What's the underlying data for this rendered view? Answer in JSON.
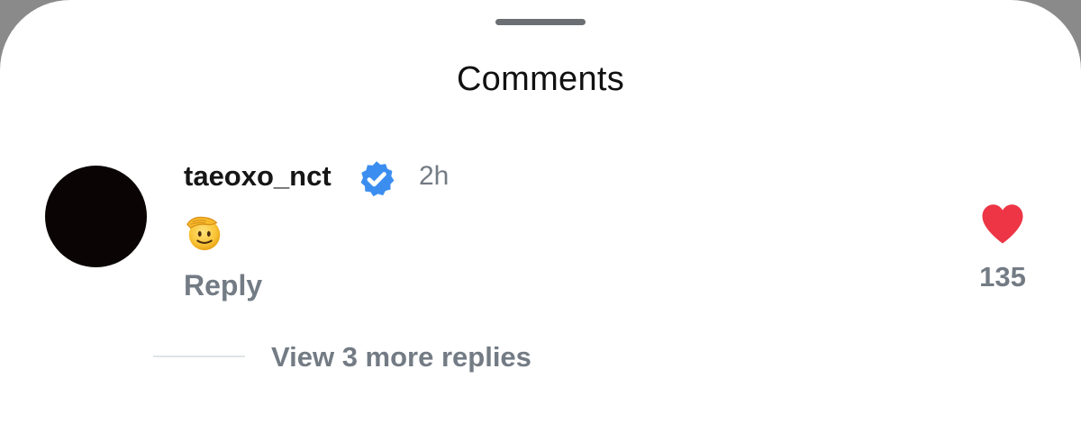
{
  "sheet": {
    "title": "Comments"
  },
  "comment": {
    "username": "taeoxo_nct",
    "verified": true,
    "timestamp": "2h",
    "body_emoji": "saluting-face",
    "reply_label": "Reply",
    "like_count": "135",
    "liked": true,
    "view_replies_label": "View 3 more replies"
  },
  "colors": {
    "background_dim": "#8a8a8a",
    "sheet": "#ffffff",
    "handle": "#6b6f73",
    "primary_text": "#111111",
    "secondary_text": "#737b84",
    "verified_badge": "#3b8ef0",
    "like": "#ed3546",
    "avatar": "#0a0504"
  },
  "icons": {
    "verified": "verified-badge-icon",
    "like": "heart-icon",
    "emoji": "saluting-face-emoji"
  }
}
